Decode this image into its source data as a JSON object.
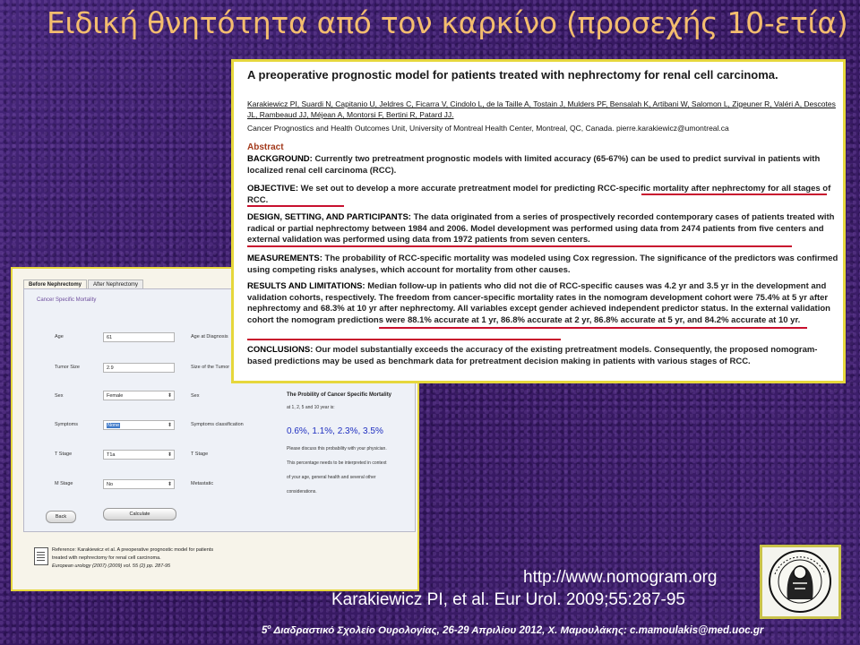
{
  "slide": {
    "title": "Ειδική θνητότητα από τον καρκίνο (προσεχής 10-ετία)",
    "url": "http://www.nomogram.org",
    "citation": "Karakiewicz PI, et al. Eur Urol. 2009;55:287-95",
    "footer_sup": "ο",
    "footer_prefix": "5",
    "footer_text": "Διαδραστικό Σχολείο Ουρολογίας, 26-29 Απριλίου 2012, Χ. Μαμουλάκης: c.mamoulakis@med.uoc.gr",
    "logo_icon": "medical-school-seal-icon"
  },
  "app": {
    "tabs": [
      "Before Nephrectomy",
      "After Nephrectomy"
    ],
    "panel_heading": "Cancer Specific Mortality",
    "fields": {
      "age_label": "Age",
      "age_value": "61",
      "age_at_diagnosis_label": "Age at Diagnosis",
      "tumor_size_label": "Tumor Size",
      "tumor_size_value": "2.9",
      "size_of_tumor_label": "Size of the Tumor",
      "sex_label": "Sex",
      "sex_value": "Female",
      "sex_right_label": "Sex",
      "symptoms_label": "Symptoms",
      "symptoms_value": "None",
      "symptoms_class_label": "Symptoms classification",
      "t_stage_label": "T Stage",
      "t_stage_value": "T1a",
      "t_stage_right_label": "T Stage",
      "m_stage_label": "M Stage",
      "m_stage_value": "No",
      "metastatic_label": "Metastatic"
    },
    "result": {
      "title": "The Probility of Cancer Specific Mortality",
      "subtitle": "at 1, 2, 5 and 10 year is:",
      "values": "0.6%, 1.1%, 2.3%, 3.5%",
      "note1": "Please discuss this probability with your physician.",
      "note2": "This percentage needs to be interpreted in context",
      "note3": "of your age, general health and several other",
      "note4": "considerations."
    },
    "back_button": "Back",
    "calculate_button": "Calculate",
    "reference_line1": "Reference: Karakiewicz et al. A preoperative prognostic model for patients",
    "reference_line2": "treated with nephrectomy for renal cell carcinoma.",
    "reference_line3": "European urology (2007) (2009) vol. 55 (2) pp. 287-95"
  },
  "abstract": {
    "title": "A preoperative prognostic model for patients treated with nephrectomy for renal cell carcinoma.",
    "authors": "Karakiewicz PI, Suardi N, Capitanio U, Jeldres C, Ficarra V, Cindolo L, de la Taille A, Tostain J, Mulders PF, Bensalah K, Artibani W, Salomon L, Zigeuner R, Valéri A, Descotes JL, Rambeaud JJ, Méjean A, Montorsi F, Bertini R, Patard JJ.",
    "affiliation": "Cancer Prognostics and Health Outcomes Unit, University of Montreal Health Center, Montreal, QC, Canada. pierre.karakiewicz@umontreal.ca",
    "heading": "Abstract",
    "background_label": "BACKGROUND:",
    "background_text": " Currently two pretreatment prognostic models with limited accuracy (65-67%) can be used to predict survival in patients with localized renal cell carcinoma (RCC).",
    "objective_label": "OBJECTIVE:",
    "objective_text": " We set out to develop a more accurate pretreatment model for predicting RCC-specific mortality after nephrectomy for all stages of RCC.",
    "design_label": "DESIGN, SETTING, AND PARTICIPANTS:",
    "design_text": " The data originated from a series of prospectively recorded contemporary cases of patients treated with radical or partial nephrectomy between 1984 and 2006. Model development was performed using data from 2474 patients from five centers and external validation was performed using data from 1972 patients from seven centers.",
    "measurements_label": "MEASUREMENTS:",
    "measurements_text": " The probability of RCC-specific mortality was modeled using Cox regression. The significance of the predictors was confirmed using competing risks analyses, which account for mortality from other causes.",
    "results_label": "RESULTS AND LIMITATIONS:",
    "results_text": " Median follow-up in patients who did not die of RCC-specific causes was 4.2 yr and 3.5 yr in the development and validation cohorts, respectively. The freedom from cancer-specific mortality rates in the nomogram development cohort were 75.4% at 5 yr after nephrectomy and 68.3% at 10 yr after nephrectomy. All variables except gender achieved independent predictor status. In the external validation cohort the nomogram predictions were 88.1% accurate at 1 yr, 86.8% accurate at 2 yr, 86.8% accurate at 5 yr, and 84.2% accurate at 10 yr.",
    "conclusions_label": "CONCLUSIONS:",
    "conclusions_text": " Our model substantially exceeds the accuracy of the existing pretreatment models. Consequently, the proposed nomogram-based predictions may be used as benchmark data for pretreatment decision making in patients with various stages of RCC."
  }
}
